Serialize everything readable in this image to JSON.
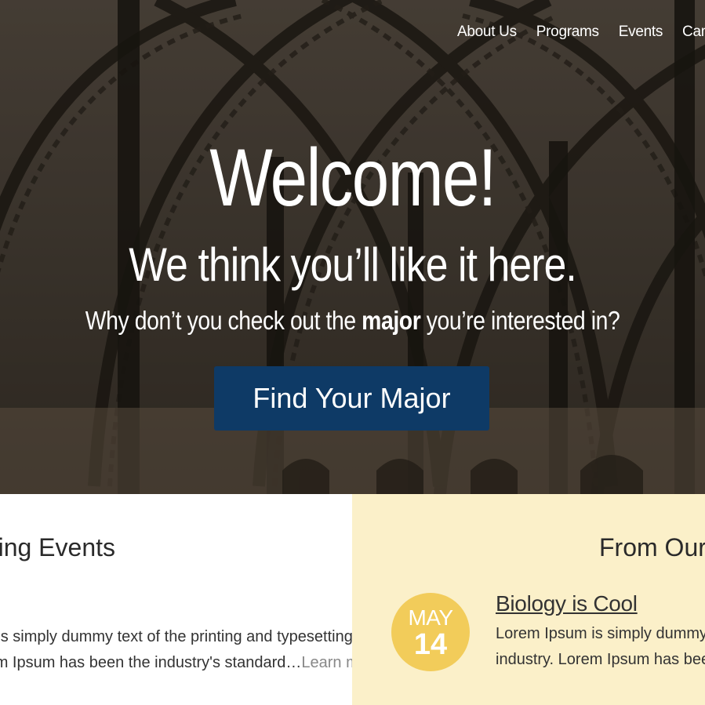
{
  "nav": {
    "items": [
      "About Us",
      "Programs",
      "Events",
      "Campus"
    ]
  },
  "hero": {
    "title": "Welcome!",
    "tagline": "We think you’ll like it here.",
    "subline_pre": "Why don’t you check out the ",
    "subline_bold": "major",
    "subline_post": " you’re interested in?",
    "cta_label": "Find Your Major"
  },
  "events": {
    "heading": "Upcoming Events",
    "excerpt_line1": "Lorem Ipsum is simply dummy text of the printing and typesetting",
    "excerpt_line2": "industry. Lorem Ipsum has been the industry's standard…",
    "learn_more": "Learn more"
  },
  "news": {
    "heading": "From Our Blog",
    "date_month": "MAY",
    "date_day": "14",
    "post_title": "Biology is Cool",
    "excerpt_line1": "Lorem Ipsum is simply dummy text of the printing and typesetting",
    "excerpt_line2": "industry. Lorem Ipsum has been the industry's standard"
  },
  "colors": {
    "cta_bg": "#0e3a66",
    "news_bg": "#fbf0c9",
    "date_badge": "#f2cc5a"
  }
}
